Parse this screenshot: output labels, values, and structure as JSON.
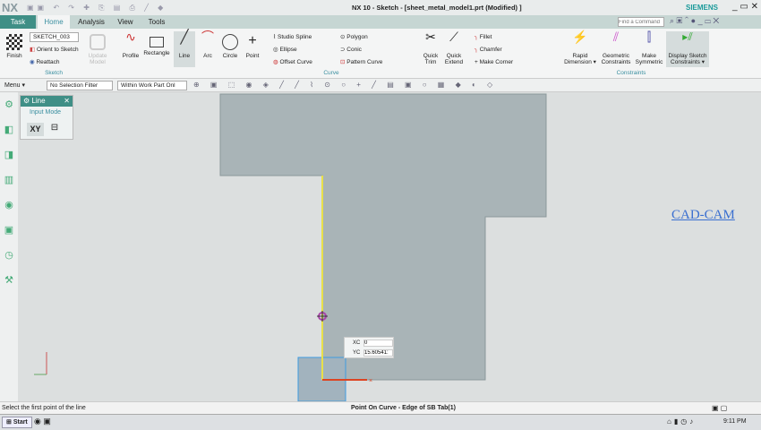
{
  "app": {
    "logo": "NX",
    "title": "NX 10 - Sketch - [sheet_metal_model1.prt (Modified) ]",
    "brand": "SIEMENS",
    "find_placeholder": "Find a Command"
  },
  "tabs": [
    "Task",
    "Home",
    "Analysis",
    "View",
    "Tools"
  ],
  "ribbon": {
    "sketch_group": {
      "finish": "Finish",
      "sketch_name": "SKETCH_003",
      "orient": "Orient to Sketch",
      "reattach": "Reattach",
      "update": "Update Model",
      "label": "Sketch"
    },
    "curve_group": {
      "profile": "Profile",
      "rectangle": "Rectangle",
      "line": "Line",
      "arc": "Arc",
      "circle": "Circle",
      "point": "Point",
      "studio_spline": "Studio Spline",
      "ellipse": "Ellipse",
      "offset_curve": "Offset Curve",
      "polygon": "Polygon",
      "conic": "Conic",
      "pattern_curve": "Pattern Curve",
      "quick_trim": "Quick Trim",
      "quick_extend": "Quick Extend",
      "fillet": "Fillet",
      "chamfer": "Chamfer",
      "make_corner": "Make Corner",
      "label": "Curve"
    },
    "constraints_group": {
      "rapid_dimension": "Rapid Dimension ▾",
      "geometric": "Geometric Constraints",
      "make_symmetric": "Make Symmetric",
      "display_sketch": "Display Sketch Constraints ▾",
      "label": "Constraints"
    }
  },
  "toolbar": {
    "menu": "Menu ▾",
    "selection_filter": "No Selection Filter",
    "scope": "Within Work Part Onl"
  },
  "dialog": {
    "title": "Line",
    "input_mode": "Input Mode",
    "xy": "XY"
  },
  "input_box": {
    "xc_label": "XC",
    "xc_value": "0",
    "yc_label": "YC",
    "yc_value": "15.60541:"
  },
  "watermark": "CAD-CAM",
  "status": {
    "prompt": "Select the first point of the line",
    "snap": "Point On Curve - Edge of SB Tab(1)"
  },
  "taskbar": {
    "start": "Start",
    "time": "9:11 PM"
  }
}
